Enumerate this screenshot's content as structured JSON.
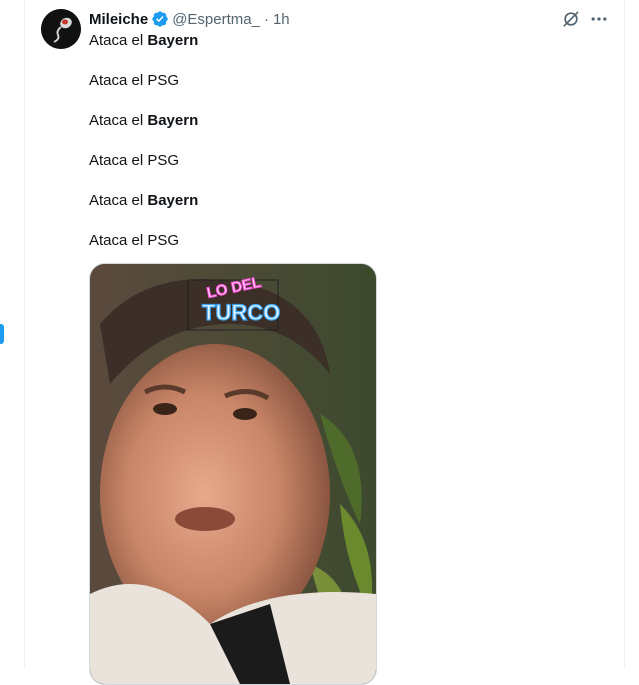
{
  "tweet": {
    "display_name": "Mileiche",
    "handle": "@Espertma_",
    "separator": "·",
    "time": "1h",
    "lines": [
      {
        "prefix": "Ataca el ",
        "bold": "Bayern"
      },
      {
        "prefix": "Ataca el PSG",
        "bold": ""
      },
      {
        "prefix": "Ataca el ",
        "bold": "Bayern"
      },
      {
        "prefix": "Ataca el PSG",
        "bold": ""
      },
      {
        "prefix": "Ataca el ",
        "bold": "Bayern"
      },
      {
        "prefix": "Ataca el PSG",
        "bold": ""
      }
    ],
    "media": {
      "sign_top": "LO DEL",
      "sign_main": "TURCO"
    }
  },
  "icons": {
    "verified": "verified-badge-icon",
    "grok": "grok-icon",
    "more": "more-icon"
  },
  "colors": {
    "accent": "#1d9bf0",
    "text": "#0f1419",
    "secondary": "#536471",
    "neon_pink": "#ff4fd8",
    "neon_blue": "#35a7ff"
  }
}
